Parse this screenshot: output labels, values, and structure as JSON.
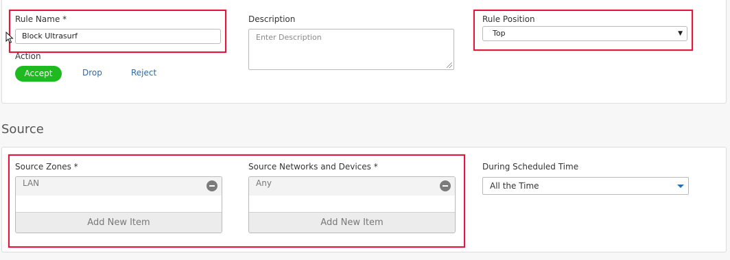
{
  "rule": {
    "name_label": "Rule Name *",
    "name_value": "Block Ultrasurf",
    "description_label": "Description",
    "description_placeholder": "Enter Description",
    "position_label": "Rule Position",
    "position_value": "Top",
    "action_label": "Action",
    "actions": [
      "Accept",
      "Drop",
      "Reject"
    ],
    "selected_action": "Accept"
  },
  "source": {
    "title": "Source",
    "zones_label": "Source Zones *",
    "zones_items": [
      "LAN"
    ],
    "networks_label": "Source Networks and Devices *",
    "networks_items": [
      "Any"
    ],
    "add_item_label": "Add New Item",
    "schedule_label": "During Scheduled Time",
    "schedule_value": "All the Time"
  },
  "colors": {
    "accept": "#1fba1f",
    "link": "#2a6aa8",
    "highlight": "#e0163c",
    "dropdown_caret": "#1a73c8"
  },
  "icons": {
    "remove": "remove-icon",
    "cursor": "mouse-cursor-icon",
    "select": "chevron-down-icon",
    "dropdown": "caret-down-icon"
  }
}
